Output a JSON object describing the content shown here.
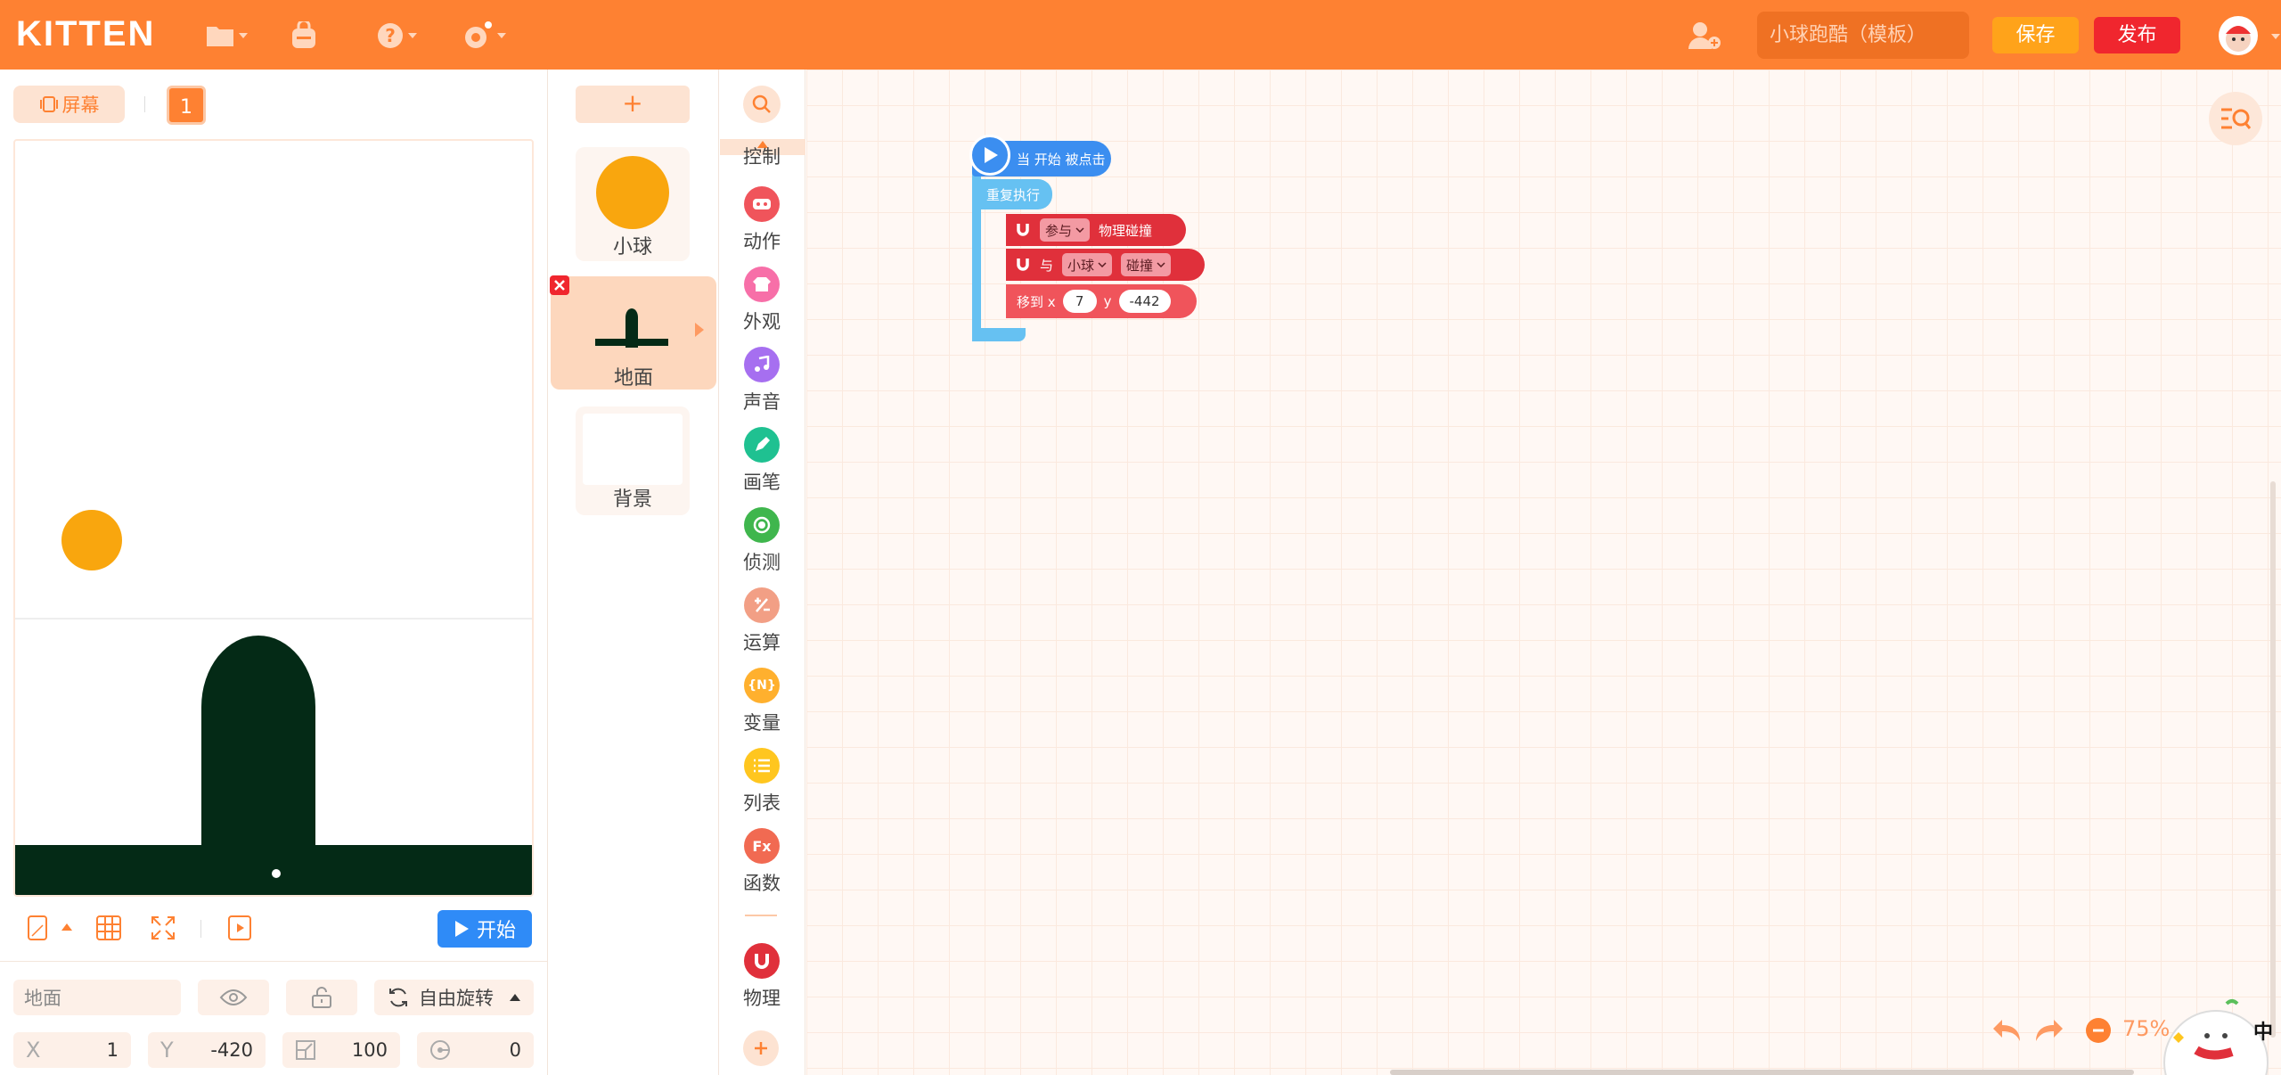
{
  "header": {
    "logo": "KITTEN",
    "project_name": "小球跑酷（模板）",
    "save_label": "保存",
    "publish_label": "发布"
  },
  "stage": {
    "screen_label": "屏幕",
    "screen_number": "1",
    "start_label": "开始"
  },
  "properties": {
    "name": "地面",
    "rotation_mode": "自由旋转",
    "x_label": "X",
    "x_value": "1",
    "y_label": "Y",
    "y_value": "-420",
    "scale_value": "100",
    "direction_value": "0"
  },
  "sprites": {
    "add_label": "+",
    "items": [
      {
        "label": "小球"
      },
      {
        "label": "地面"
      },
      {
        "label": "背景"
      }
    ]
  },
  "categories": [
    {
      "label": "控制",
      "color": "#fe8132",
      "icon": "control-icon"
    },
    {
      "label": "动作",
      "color": "#f0545b",
      "icon": "motion-icon"
    },
    {
      "label": "外观",
      "color": "#f76fa8",
      "icon": "looks-icon"
    },
    {
      "label": "声音",
      "color": "#a66ff0",
      "icon": "sound-icon"
    },
    {
      "label": "画笔",
      "color": "#1fc191",
      "icon": "pen-icon"
    },
    {
      "label": "侦测",
      "color": "#3fb64d",
      "icon": "sensing-icon"
    },
    {
      "label": "运算",
      "color": "#f29f85",
      "icon": "operators-icon"
    },
    {
      "label": "变量",
      "color": "#ffb02e",
      "icon": "variables-icon"
    },
    {
      "label": "列表",
      "color": "#ffc61f",
      "icon": "list-icon"
    },
    {
      "label": "函数",
      "color": "#f16a52",
      "icon": "functions-icon"
    },
    {
      "label": "物理",
      "color": "#e0303b",
      "icon": "physics-icon"
    }
  ],
  "blocks": {
    "hat": "当 开始 被点击",
    "repeat": "重复执行",
    "physics1_dropdown": "参与",
    "physics1_text": "物理碰撞",
    "physics2_with": "与",
    "physics2_target": "小球",
    "physics2_event": "碰撞",
    "move_label": "移到 x",
    "move_x": "7",
    "move_y_label": "y",
    "move_y": "-442"
  },
  "workspace": {
    "zoom": "75%",
    "ime_label": "中"
  }
}
